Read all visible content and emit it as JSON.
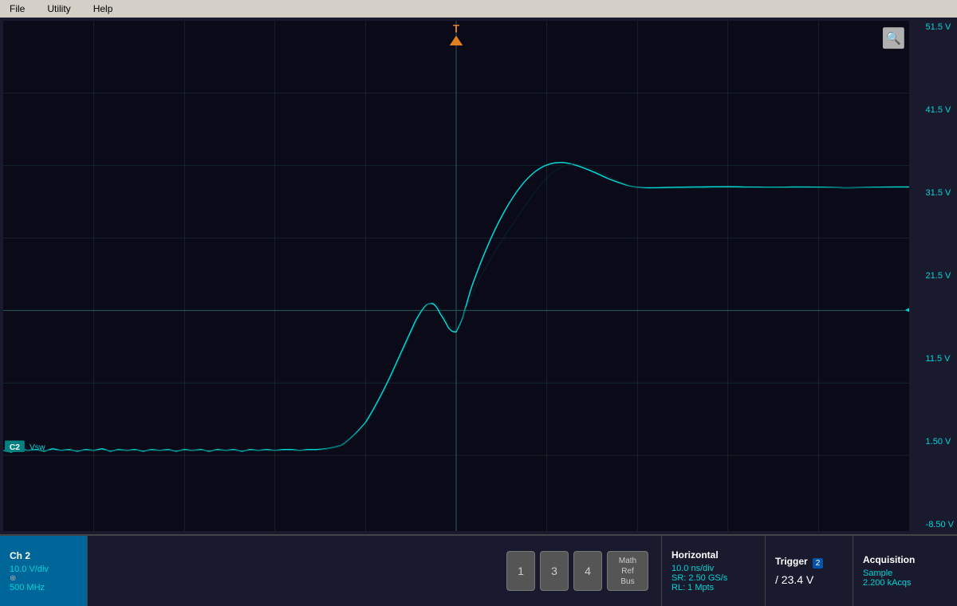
{
  "menubar": {
    "items": [
      "File",
      "Utility",
      "Help"
    ]
  },
  "scope": {
    "background_color": "#0a0a18",
    "grid_color": "#1e3a3a",
    "waveform_color": "#00d4d4",
    "voltage_labels": [
      "51.5 V",
      "41.5 V",
      "31.5 V",
      "21.5 V",
      "11.5 V",
      "1.50 V",
      "-8.50 V"
    ],
    "trigger_label": "T",
    "zoom_icon": "🔍",
    "cursor_arrow": "◄",
    "ch2_label": "C2",
    "vsw_label": "Vsw"
  },
  "status_bar": {
    "ch2": {
      "title": "Ch 2",
      "v_div": "10.0 V/div",
      "bandwidth": "500 MHz"
    },
    "channels": {
      "buttons": [
        "1",
        "3",
        "4"
      ],
      "math_ref_bus": [
        "Math",
        "Ref",
        "Bus"
      ]
    },
    "horizontal": {
      "title": "Horizontal",
      "time_div": "10.0 ns/div",
      "sample_rate": "SR: 2.50 GS/s",
      "record_length": "RL: 1 Mpts"
    },
    "trigger": {
      "title": "Trigger",
      "channel": "2",
      "value": "23.4 V",
      "icon": "/"
    },
    "acquisition": {
      "title": "Acquisition",
      "mode": "Sample",
      "count": "2.200 kAcqs"
    }
  }
}
